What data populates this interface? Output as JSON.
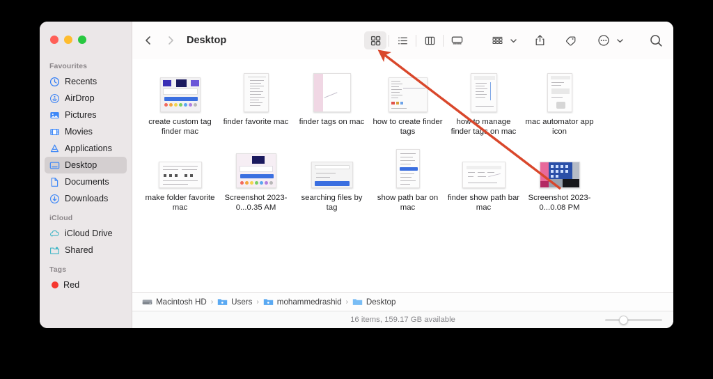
{
  "window": {
    "title": "Desktop",
    "traffic_lights": [
      {
        "name": "close",
        "color": "#ff5f57"
      },
      {
        "name": "minimize",
        "color": "#febc2e"
      },
      {
        "name": "zoom",
        "color": "#28c840"
      }
    ]
  },
  "sidebar": {
    "sections": [
      {
        "label": "Favourites",
        "items": [
          {
            "label": "Recents",
            "icon": "clock-icon",
            "selected": false
          },
          {
            "label": "AirDrop",
            "icon": "airdrop-icon",
            "selected": false
          },
          {
            "label": "Pictures",
            "icon": "pictures-icon",
            "selected": false
          },
          {
            "label": "Movies",
            "icon": "movies-icon",
            "selected": false
          },
          {
            "label": "Applications",
            "icon": "applications-icon",
            "selected": false
          },
          {
            "label": "Desktop",
            "icon": "desktop-icon",
            "selected": true
          },
          {
            "label": "Documents",
            "icon": "document-icon",
            "selected": false
          },
          {
            "label": "Downloads",
            "icon": "downloads-icon",
            "selected": false
          }
        ]
      },
      {
        "label": "iCloud",
        "items": [
          {
            "label": "iCloud Drive",
            "icon": "cloud-icon",
            "selected": false
          },
          {
            "label": "Shared",
            "icon": "shared-folder-icon",
            "selected": false
          }
        ]
      },
      {
        "label": "Tags",
        "items": [
          {
            "label": "Red",
            "icon": "tag-dot-icon",
            "color": "#f5372f",
            "selected": false
          }
        ]
      }
    ]
  },
  "toolbar": {
    "back_label": "Back",
    "forward_label": "Forward",
    "view_buttons": [
      {
        "name": "icon-view",
        "label": "as Icons",
        "active": true
      },
      {
        "name": "list-view",
        "label": "as List",
        "active": false
      },
      {
        "name": "column-view",
        "label": "as Columns",
        "active": false
      },
      {
        "name": "gallery-view",
        "label": "as Gallery",
        "active": false
      }
    ],
    "group_button_label": "Group items",
    "share_button_label": "Share",
    "tags_button_label": "Edit Tags",
    "more_button_label": "More",
    "search_button_label": "Search"
  },
  "files": [
    {
      "name": "create custom tag finder mac",
      "thumb": "colorful-tag-panel"
    },
    {
      "name": "finder favorite mac",
      "thumb": "text-document"
    },
    {
      "name": "finder tags on mac",
      "thumb": "pink-sidebar-doc"
    },
    {
      "name": "how to create finder tags",
      "thumb": "menu-screenshot"
    },
    {
      "name": "how to manage finder tags on mac",
      "thumb": "list-document"
    },
    {
      "name": "mac automator app icon",
      "thumb": "automator-doc"
    },
    {
      "name": "make folder favorite mac",
      "thumb": "wide-settings-panel"
    },
    {
      "name": "Screenshot 2023-0...0.35 AM",
      "thumb": "tag-color-picker"
    },
    {
      "name": "searching files by tag",
      "thumb": "dialog-box"
    },
    {
      "name": "show path bar on mac",
      "thumb": "tall-menu"
    },
    {
      "name": "finder show path bar mac",
      "thumb": "wide-toolbar"
    },
    {
      "name": "Screenshot 2023-0...0.08 PM",
      "thumb": "desktop-wallpaper"
    }
  ],
  "pathbar": {
    "crumbs": [
      {
        "label": "Macintosh HD",
        "icon": "harddisk-icon"
      },
      {
        "label": "Users",
        "icon": "users-folder-icon"
      },
      {
        "label": "mohammedrashid",
        "icon": "home-folder-icon"
      },
      {
        "label": "Desktop",
        "icon": "folder-icon"
      }
    ],
    "separator": "›"
  },
  "statusbar": {
    "text": "16 items, 159.17 GB available",
    "zoom_slider_label": "Icon size"
  },
  "annotation": {
    "arrow_color": "#d9472b",
    "arrow_name": "red-pointer-arrow",
    "points_to": "icon-view"
  }
}
